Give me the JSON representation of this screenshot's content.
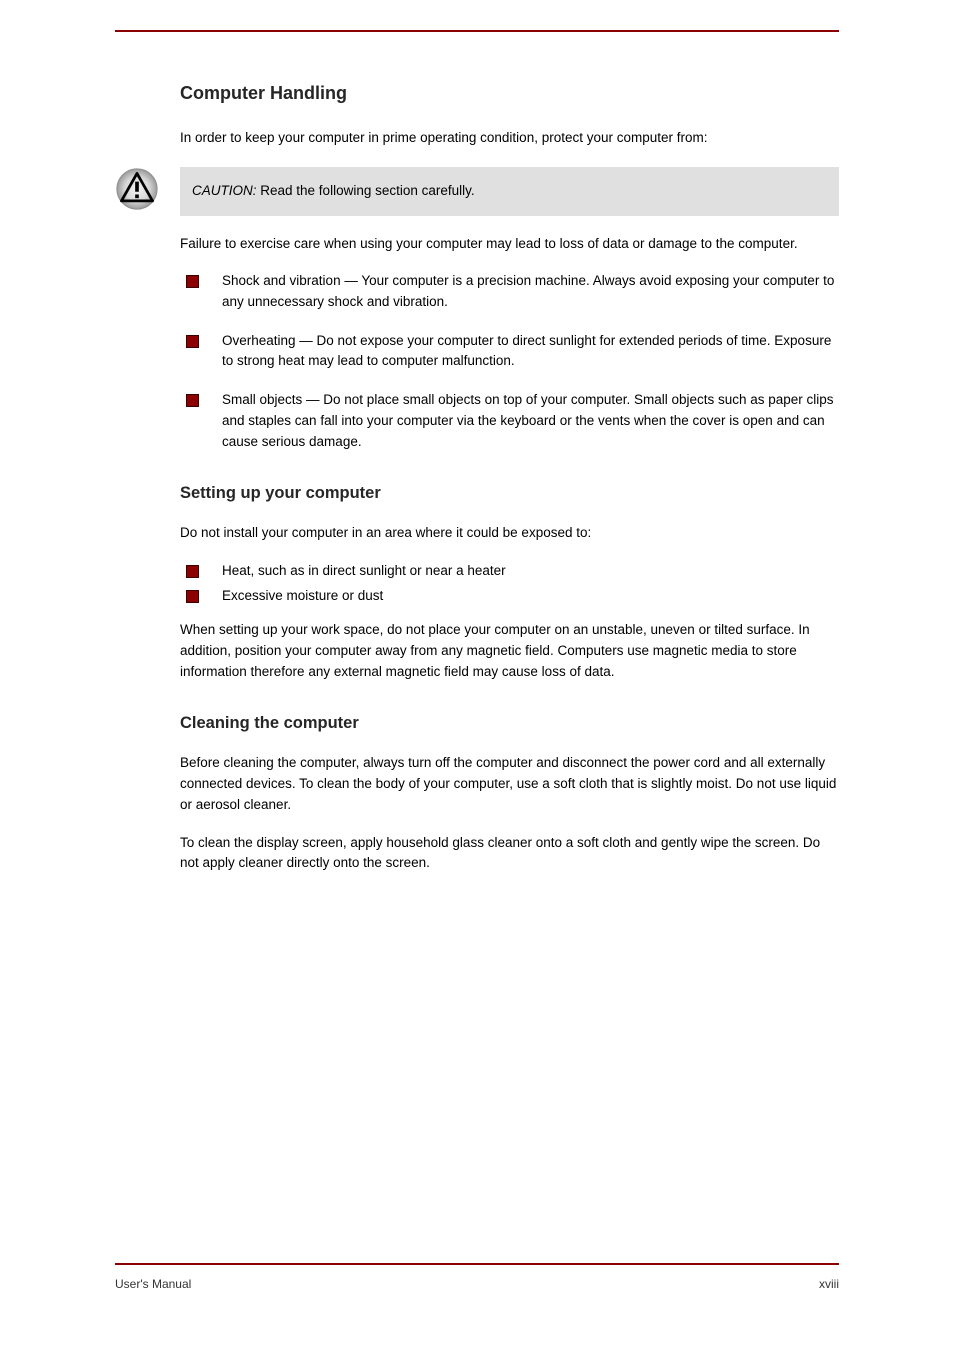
{
  "section_title": "Computer Handling",
  "intro": "In order to keep your computer in prime operating condition, protect your computer from:",
  "caution": {
    "heading_italic": "CAUTION:",
    "heading_rest": " Read the following section carefully.",
    "body": "Failure to exercise care when using your computer may lead to loss of data or damage to the computer."
  },
  "bullets_main": [
    "Shock and vibration — Your computer is a precision machine. Always avoid exposing your computer to any unnecessary shock and vibration.",
    "Overheating — Do not expose your computer to direct sunlight for extended periods of time. Exposure to strong heat may lead to computer malfunction.",
    "Small objects — Do not place small objects on top of your computer. Small objects such as paper clips and staples can fall into your computer via the keyboard or the vents when the cover is open and can cause serious damage."
  ],
  "sub1": {
    "title": "Setting up your computer",
    "p1": "Do not install your computer in an area where it could be exposed to:",
    "bullets": [
      "Heat, such as in direct sunlight or near a heater",
      "Excessive moisture or dust"
    ],
    "p2": "When setting up your work space, do not place your computer on an unstable, uneven or tilted surface. In addition, position your computer away from any magnetic field. Computers use magnetic media to store information therefore any external magnetic field may cause loss of data."
  },
  "sub2": {
    "title": "Cleaning the computer",
    "p1": "Before cleaning the computer, always turn off the computer and disconnect the power cord and all externally connected devices. To clean the body of your computer, use a soft cloth that is slightly moist. Do not use liquid or aerosol cleaner.",
    "p2": "To clean the display screen, apply household glass cleaner onto a soft cloth and gently wipe the screen. Do not apply cleaner directly onto the screen."
  },
  "footer": {
    "left": "User's Manual",
    "right": "xviii"
  }
}
